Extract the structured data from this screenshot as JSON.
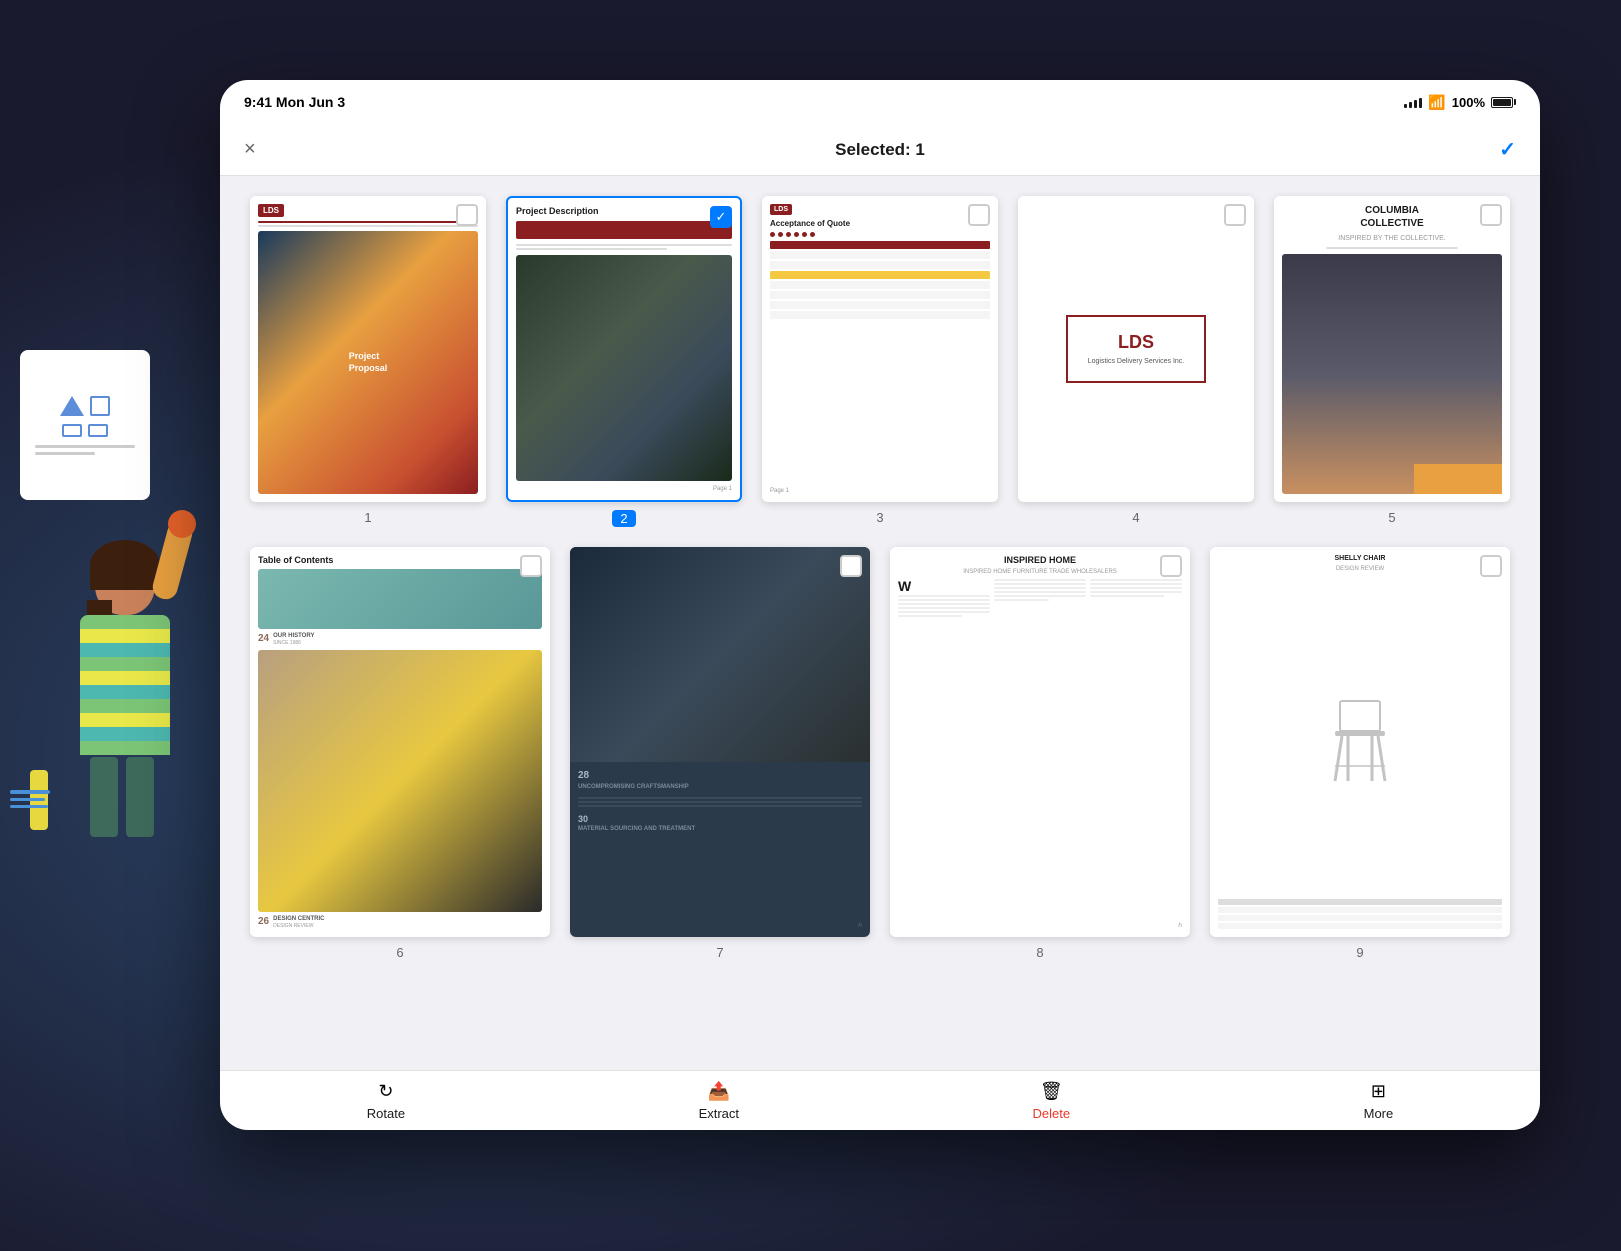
{
  "app": {
    "status_bar": {
      "time": "9:41 Mon Jun 3",
      "battery": "100%"
    },
    "nav": {
      "title": "Selected: 1",
      "close_label": "×",
      "confirm_label": "✓"
    },
    "toolbar": {
      "rotate_label": "Rotate",
      "extract_label": "Extract",
      "delete_label": "Delete",
      "more_label": "More"
    }
  },
  "pages": [
    {
      "number": "1",
      "selected": false,
      "title": "Project Proposal",
      "type": "project_proposal"
    },
    {
      "number": "2",
      "selected": true,
      "title": "Project Description",
      "type": "project_description"
    },
    {
      "number": "3",
      "selected": false,
      "title": "Acceptance of Quote",
      "type": "acceptance_quote"
    },
    {
      "number": "4",
      "selected": false,
      "title": "LDS Logo",
      "type": "lds_logo",
      "lds_text": "LDS",
      "lds_sub": "Logistics Delivery Services Inc."
    },
    {
      "number": "5",
      "selected": false,
      "title": "Columbia Collective",
      "type": "columbia_collective",
      "main": "COLUMBIA",
      "sub": "COLLECTIVE",
      "tagline": "INSPIRED BY THE COLLECTIVE."
    },
    {
      "number": "6",
      "selected": false,
      "title": "Table of Contents",
      "type": "table_of_contents",
      "entries": [
        {
          "num": "24",
          "title": "OUR HISTORY",
          "sub": "SINCE 1986"
        },
        {
          "num": "26",
          "title": "DESIGN CENTRIC",
          "sub": "DESIGN REVIEW"
        }
      ]
    },
    {
      "number": "7",
      "selected": false,
      "title": "Uncompromising Craftsmanship",
      "type": "craftsmanship",
      "num1": "28",
      "text1": "UNCOMPROMISING CRAFTSMANSHIP",
      "num2": "30",
      "text2": "MATERIAL SOURCING AND TREATMENT"
    },
    {
      "number": "8",
      "selected": false,
      "title": "Inspired Home",
      "type": "inspired_home",
      "heading": "INSPIRED HOME"
    },
    {
      "number": "9",
      "selected": false,
      "title": "Shelly Chair Design Review",
      "type": "shelly_chair",
      "title_text": "SHELLY CHAIR",
      "sub_text": "DESIGN REVIEW"
    }
  ]
}
